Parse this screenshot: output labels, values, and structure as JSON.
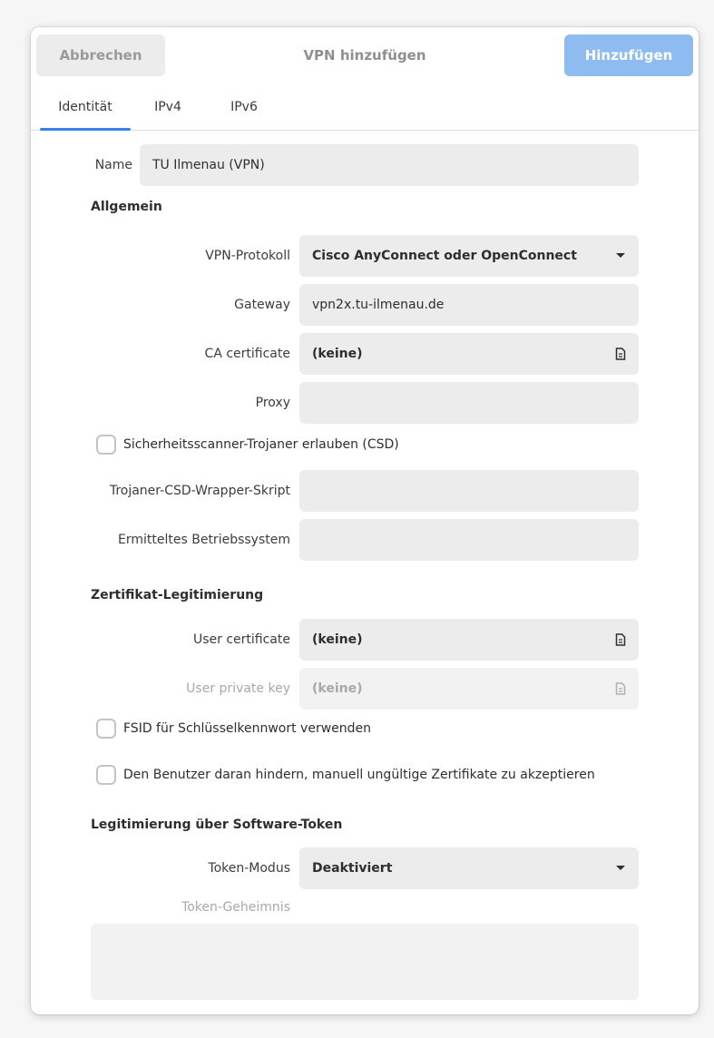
{
  "header": {
    "cancel_label": "Abbrechen",
    "title": "VPN hinzufügen",
    "add_label": "Hinzufügen"
  },
  "tabs": [
    {
      "label": "Identität",
      "active": true
    },
    {
      "label": "IPv4",
      "active": false
    },
    {
      "label": "IPv6",
      "active": false
    }
  ],
  "name": {
    "label": "Name",
    "value": "TU Ilmenau (VPN)"
  },
  "general": {
    "title": "Allgemein",
    "protocol": {
      "label": "VPN-Protokoll",
      "value": "Cisco AnyConnect oder OpenConnect",
      "icon": "chevron-down-icon"
    },
    "gateway": {
      "label": "Gateway",
      "value": "vpn2x.tu-ilmenau.de"
    },
    "ca_certificate": {
      "label": "CA certificate",
      "value": "(keine)",
      "icon": "document-icon"
    },
    "proxy": {
      "label": "Proxy",
      "value": ""
    },
    "csd_checkbox": {
      "label": "Sicherheitsscanner-Trojaner erlauben (CSD)",
      "checked": false
    },
    "csd_wrapper": {
      "label": "Trojaner-CSD-Wrapper-Skript",
      "value": ""
    },
    "reported_os": {
      "label": "Ermitteltes Betriebssystem",
      "value": ""
    }
  },
  "cert_auth": {
    "title": "Zertifikat-Legitimierung",
    "user_certificate": {
      "label": "User certificate",
      "value": "(keine)",
      "icon": "document-icon"
    },
    "user_private_key": {
      "label": "User private key",
      "value": "(keine)",
      "icon": "document-icon",
      "disabled": true
    },
    "fsid_checkbox": {
      "label": "FSID für Schlüsselkennwort verwenden",
      "checked": false
    },
    "prevent_invalid_certs_checkbox": {
      "label": "Den Benutzer daran hindern, manuell ungültige Zertifikate zu akzeptieren",
      "checked": false
    }
  },
  "token_auth": {
    "title": "Legitimierung über Software-Token",
    "mode": {
      "label": "Token-Modus",
      "value": "Deaktiviert",
      "icon": "chevron-down-icon"
    },
    "secret": {
      "label": "Token-Geheimnis",
      "value": ""
    }
  },
  "colors": {
    "accent": "#3584e4",
    "add_button": "#8fbcf0",
    "field_bg": "#ececec"
  }
}
